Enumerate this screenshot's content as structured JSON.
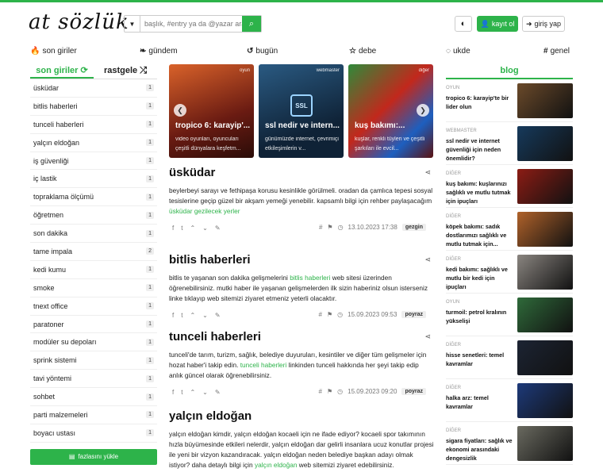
{
  "header": {
    "logo": "at sözlük",
    "search_placeholder": "başlık, #entry ya da @yazar ara",
    "theme_icon": "contrast-icon",
    "register_label": "kayıt ol",
    "login_label": "giriş yap"
  },
  "nav": [
    {
      "label": "son giriler",
      "icon": "flame-icon"
    },
    {
      "label": "gündem",
      "icon": "leaf-icon"
    },
    {
      "label": "bugün",
      "icon": "history-icon"
    },
    {
      "label": "debe",
      "icon": "star-icon"
    },
    {
      "label": "ukde",
      "icon": "circle-icon"
    },
    {
      "label": "genel",
      "icon": "hash-icon"
    }
  ],
  "left": {
    "tab_active": "son giriler",
    "tab_other": "rastgele",
    "items": [
      {
        "label": "üsküdar",
        "count": "1"
      },
      {
        "label": "bitlis haberleri",
        "count": "1"
      },
      {
        "label": "tunceli haberleri",
        "count": "1"
      },
      {
        "label": "yalçın eldoğan",
        "count": "1"
      },
      {
        "label": "iş güvenliği",
        "count": "1"
      },
      {
        "label": "iç lastik",
        "count": "1"
      },
      {
        "label": "topraklama ölçümü",
        "count": "1"
      },
      {
        "label": "öğretmen",
        "count": "1"
      },
      {
        "label": "son dakika",
        "count": "1"
      },
      {
        "label": "tame impala",
        "count": "2"
      },
      {
        "label": "kedi kumu",
        "count": "1"
      },
      {
        "label": "smoke",
        "count": "1"
      },
      {
        "label": "tnext office",
        "count": "1"
      },
      {
        "label": "paratoner",
        "count": "1"
      },
      {
        "label": "modüler su depoları",
        "count": "1"
      },
      {
        "label": "sprink sistemi",
        "count": "1"
      },
      {
        "label": "tavi yöntemi",
        "count": "1"
      },
      {
        "label": "sohbet",
        "count": "1"
      },
      {
        "label": "parti malzemeleri",
        "count": "1"
      },
      {
        "label": "boyacı ustası",
        "count": "1"
      }
    ],
    "more_label": "fazlasını yükle"
  },
  "carousel": [
    {
      "cat": "oyun",
      "title": "tropico 6: karayip'...",
      "sub": "video oyunları, oyuncuları çeşitli dünyalara keşfetm...",
      "color": "#8a2a1a"
    },
    {
      "cat": "webmaster",
      "title": "ssl nedir ve intern...",
      "sub": "günümüzde internet, çevrimiçi etkileşimlerin v...",
      "color": "#14324a"
    },
    {
      "cat": "diğer",
      "title": "kuş bakımı:...",
      "sub": "kuşlar, renkli tüyleri ve çeşitli şarkıları ile evcil...",
      "color": "#7a1d14"
    }
  ],
  "entries": [
    {
      "title": "üsküdar",
      "text_before": "beylerbeyi sarayı ve fethipaşa korusu kesinlikle görülmeli. oradan da çamlıca tepesi sosyal tesislerine geçip güzel bir akşam yemeği yenebilir. kapsamlı bilgi için rehber paylaşacağım",
      "link": "üsküdar gezilecek yerler",
      "text_after": "",
      "date": "13.10.2023 17:38",
      "author": "gezgin"
    },
    {
      "title": "bitlis haberleri",
      "text_before": "bitlis te yaşanan son dakika gelişmelerini",
      "link": "bitlis haberleri",
      "text_after": "web sitesi üzerinden öğrenebilirsiniz. mutki haber ile yaşanan gelişmelerden ilk sizin haberiniz olsun isterseniz linke tıklayıp web sitemizi ziyaret etmeniz yeterli olacaktır.",
      "date": "15.09.2023 09:53",
      "author": "poyraz"
    },
    {
      "title": "tunceli haberleri",
      "text_before": "tunceli'de tarım, turizm, sağlık, belediye duyuruları, kesintiler ve diğer tüm gelişmeler için hozat haber'i takip edin.",
      "link": "tunceli haberleri",
      "text_after": "linkinden tunceli hakkında her şeyi takip edip anlık güncel olarak öğrenebilirsiniz.",
      "date": "15.09.2023 09:20",
      "author": "poyraz"
    },
    {
      "title": "yalçın eldoğan",
      "text_before": "yalçın eldoğan kimdir, yalçın eldoğan kocaeli için ne ifade ediyor? kocaeli spor takımının hızla büyümesinde etkileri nelerdir, yalçın eldoğan dar gelirli insanlara ucuz konutlar projesi ile yeni bir vizyon kazandıracak. yalçın eldoğan neden belediye başkan adayı olmak istiyor? daha detaylı bilgi için",
      "link": "yalçın eldoğan",
      "text_after": "web sitemizi ziyaret edebilirsiniz.",
      "date": "",
      "author": ""
    }
  ],
  "blog": {
    "title": "blog",
    "items": [
      {
        "cat": "OYUN",
        "title": "tropico 6: karayip'te bir lider olun",
        "color": "#6b4a2a"
      },
      {
        "cat": "WEBMASTER",
        "title": "ssl nedir ve internet güvenliği için neden önemlidir?",
        "color": "#163a5c"
      },
      {
        "cat": "DİĞER",
        "title": "kuş bakımı: kuşlarınızı sağlıklı ve mutlu tutmak için ipuçları",
        "color": "#8c1c14"
      },
      {
        "cat": "DİĞER",
        "title": "köpek bakımı: sadık dostlarımızı sağlıklı ve mutlu tutmak için...",
        "color": "#b0622a"
      },
      {
        "cat": "DİĞER",
        "title": "kedi bakımı: sağlıklı ve mutlu bir kedi için ipuçları",
        "color": "#8a8580"
      },
      {
        "cat": "OYUN",
        "title": "turmoil: petrol kralının yükselişi",
        "color": "#2f6a3a"
      },
      {
        "cat": "DİĞER",
        "title": "hisse senetleri: temel kavramlar",
        "color": "#1c2433"
      },
      {
        "cat": "DİĞER",
        "title": "halka arz: temel kavramlar",
        "color": "#1d3a7a"
      },
      {
        "cat": "DİĞER",
        "title": "sigara fiyatları: sağlık ve ekonomi arasındaki dengesizlik",
        "color": "#6a6a60"
      }
    ]
  },
  "colors": {
    "accent": "#2db34a"
  }
}
